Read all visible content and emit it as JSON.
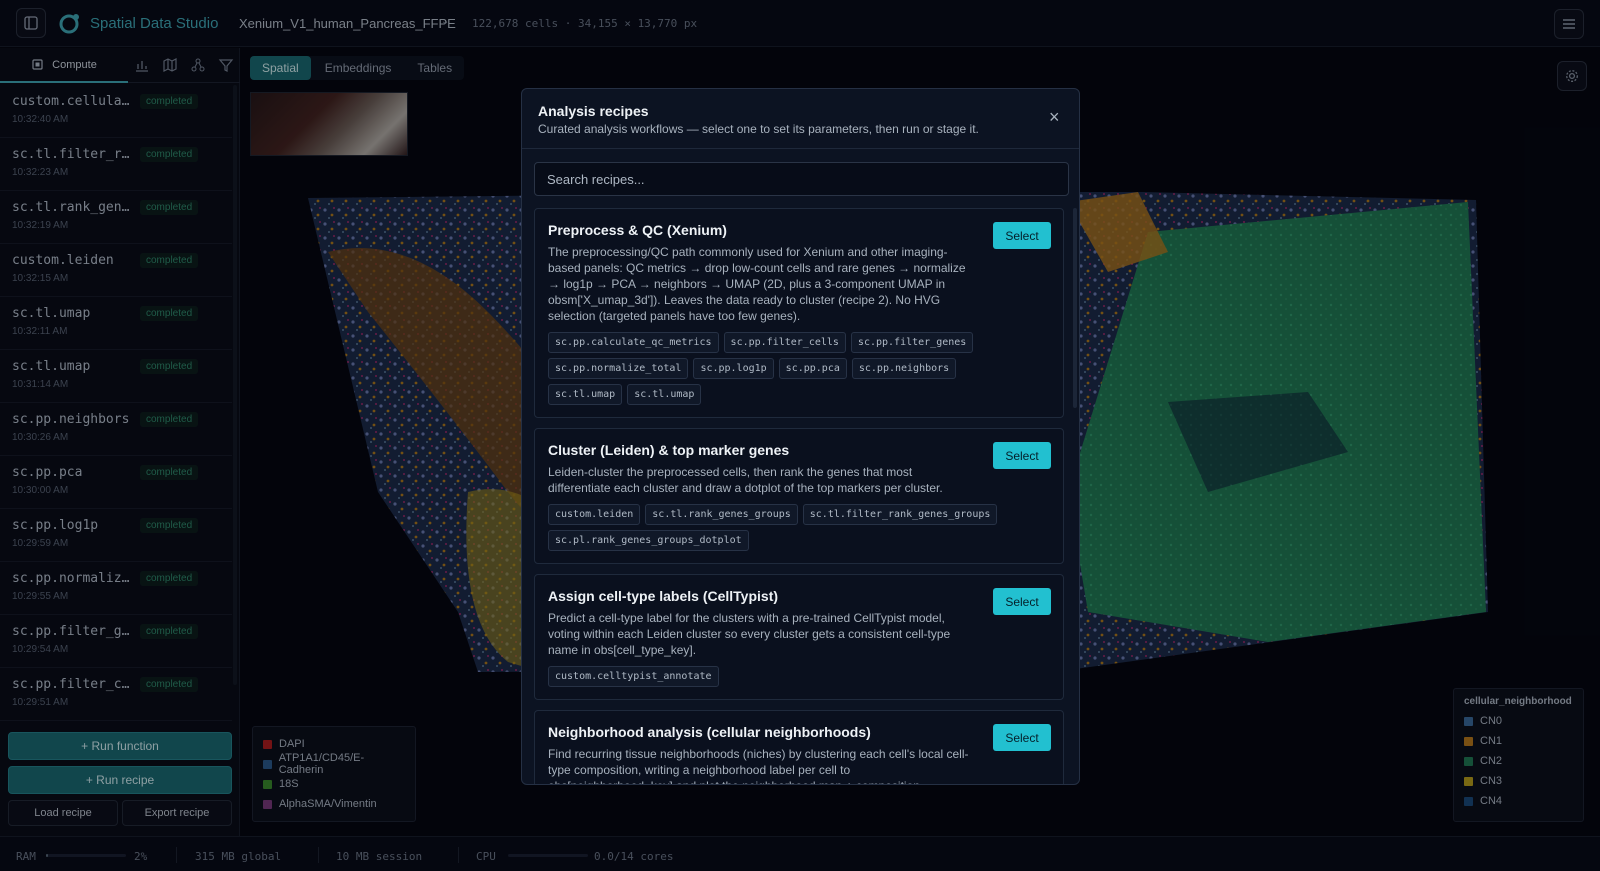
{
  "app": {
    "title": "Spatial Data Studio",
    "dataset": "Xenium_V1_human_Pancreas_FFPE",
    "cell_info": "122,678 cells · 34,155 × 13,770 px"
  },
  "sidebar": {
    "compute_tab": "Compute",
    "icons": [
      "bar-chart-icon",
      "map-icon",
      "nodes-icon",
      "filter-icon"
    ],
    "history": [
      {
        "fn": "custom.cellular_neighborhoods",
        "status": "completed",
        "time": "10:32:40 AM"
      },
      {
        "fn": "sc.tl.filter_rank_genes_groups",
        "status": "completed",
        "time": "10:32:23 AM"
      },
      {
        "fn": "sc.tl.rank_genes_groups",
        "status": "completed",
        "time": "10:32:19 AM"
      },
      {
        "fn": "custom.leiden",
        "status": "completed",
        "time": "10:32:15 AM"
      },
      {
        "fn": "sc.tl.umap",
        "status": "completed",
        "time": "10:32:11 AM"
      },
      {
        "fn": "sc.tl.umap",
        "status": "completed",
        "time": "10:31:14 AM"
      },
      {
        "fn": "sc.pp.neighbors",
        "status": "completed",
        "time": "10:30:26 AM"
      },
      {
        "fn": "sc.pp.pca",
        "status": "completed",
        "time": "10:30:00 AM"
      },
      {
        "fn": "sc.pp.log1p",
        "status": "completed",
        "time": "10:29:59 AM"
      },
      {
        "fn": "sc.pp.normalize_total",
        "status": "completed",
        "time": "10:29:55 AM"
      },
      {
        "fn": "sc.pp.filter_genes",
        "status": "completed",
        "time": "10:29:54 AM"
      },
      {
        "fn": "sc.pp.filter_cells",
        "status": "completed",
        "time": "10:29:51 AM"
      }
    ],
    "run_function": "+ Run function",
    "run_recipe": "+ Run recipe",
    "load_recipe": "Load recipe",
    "export_recipe": "Export recipe"
  },
  "view_tabs": [
    "Spatial",
    "Embeddings",
    "Tables"
  ],
  "active_view": "Spatial",
  "channel_legend": [
    {
      "label": "DAPI",
      "color": "#b01c1c"
    },
    {
      "label": "ATP1A1/CD45/E-Cadherin",
      "color": "#2a5a8a"
    },
    {
      "label": "18S",
      "color": "#3a8a2a"
    },
    {
      "label": "AlphaSMA/Vimentin",
      "color": "#7a3a7a"
    }
  ],
  "neighborhood_legend": {
    "title": "cellular_neighborhood",
    "items": [
      {
        "label": "CN0",
        "color": "#3a6a9a"
      },
      {
        "label": "CN1",
        "color": "#b87a1a"
      },
      {
        "label": "CN2",
        "color": "#1f7a52"
      },
      {
        "label": "CN3",
        "color": "#b8a01a"
      },
      {
        "label": "CN4",
        "color": "#1a4a7a"
      }
    ]
  },
  "status": {
    "ram_label": "RAM",
    "ram_pct": "2%",
    "ram_pct_value": 0.02,
    "ram_global": "315 MB global",
    "ram_session": "10 MB session",
    "cpu_label": "CPU",
    "cpu_value": "0.0/14 cores"
  },
  "modal": {
    "title": "Analysis recipes",
    "subtitle": "Curated analysis workflows — select one to set its parameters, then run or stage it.",
    "search_placeholder": "Search recipes...",
    "select_label": "Select",
    "recipes": [
      {
        "title": "Preprocess & QC (Xenium)",
        "desc": "The preprocessing/QC path commonly used for Xenium and other imaging-based panels: QC metrics → drop low-count cells and rare genes → normalize → log1p → PCA → neighbors → UMAP (2D, plus a 3-component UMAP in obsm['X_umap_3d']). Leaves the data ready to cluster (recipe 2). No HVG selection (targeted panels have too few genes).",
        "steps": [
          "sc.pp.calculate_qc_metrics",
          "sc.pp.filter_cells",
          "sc.pp.filter_genes",
          "sc.pp.normalize_total",
          "sc.pp.log1p",
          "sc.pp.pca",
          "sc.pp.neighbors",
          "sc.tl.umap",
          "sc.tl.umap"
        ]
      },
      {
        "title": "Cluster (Leiden) & top marker genes",
        "desc": "Leiden-cluster the preprocessed cells, then rank the genes that most differentiate each cluster and draw a dotplot of the top markers per cluster.",
        "steps": [
          "custom.leiden",
          "sc.tl.rank_genes_groups",
          "sc.tl.filter_rank_genes_groups",
          "sc.pl.rank_genes_groups_dotplot"
        ]
      },
      {
        "title": "Assign cell-type labels (CellTypist)",
        "desc": "Predict a cell-type label for the clusters with a pre-trained CellTypist model, voting within each Leiden cluster so every cluster gets a consistent cell-type name in obs[cell_type_key].",
        "steps": [
          "custom.celltypist_annotate"
        ]
      },
      {
        "title": "Neighborhood analysis (cellular neighborhoods)",
        "desc": "Find recurring tissue neighborhoods (niches) by clustering each cell's local cell-type composition, writing a neighborhood label per cell to obs[neighborhood_key] and plot the neighborhood map + composition.",
        "steps": []
      }
    ]
  }
}
